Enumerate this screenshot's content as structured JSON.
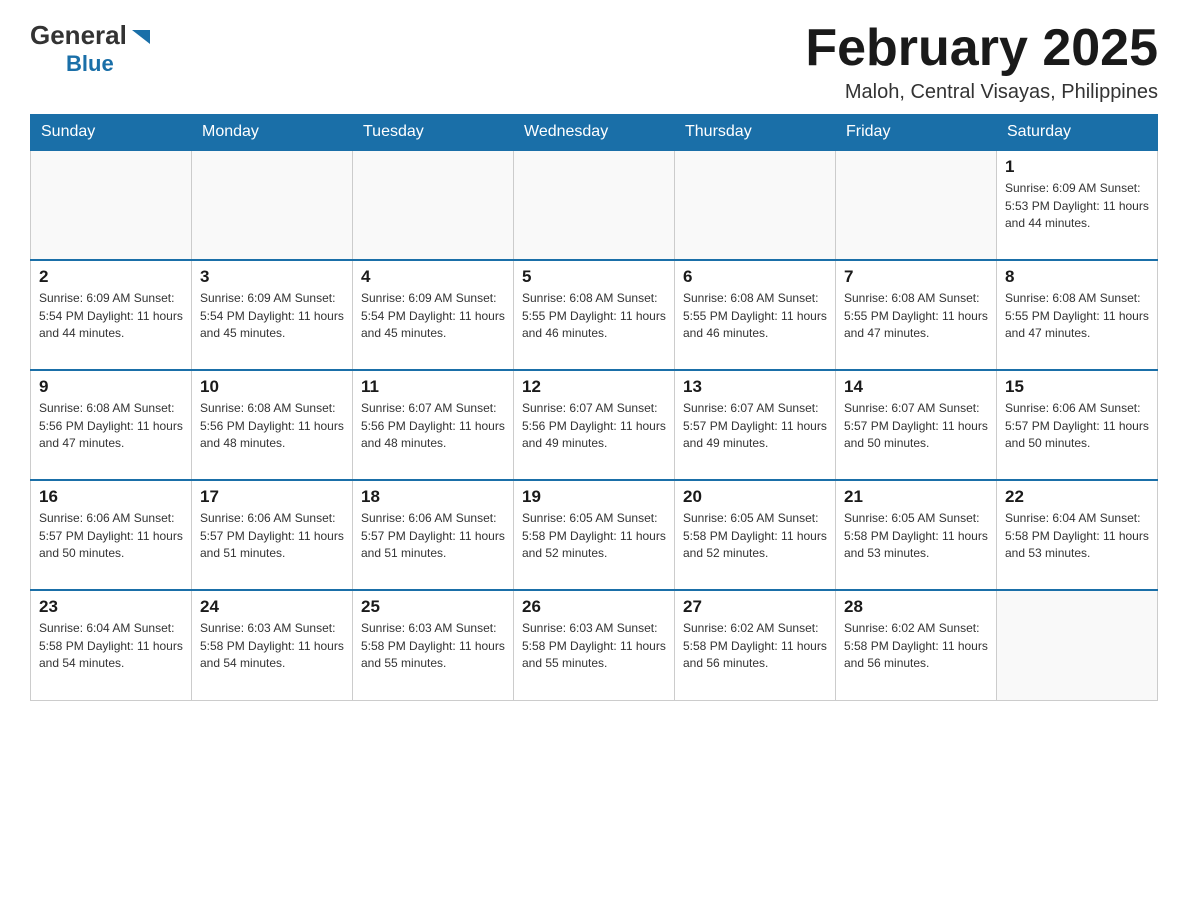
{
  "logo": {
    "general": "General",
    "blue": "Blue"
  },
  "title": "February 2025",
  "subtitle": "Maloh, Central Visayas, Philippines",
  "weekdays": [
    "Sunday",
    "Monday",
    "Tuesday",
    "Wednesday",
    "Thursday",
    "Friday",
    "Saturday"
  ],
  "weeks": [
    [
      {
        "day": "",
        "info": ""
      },
      {
        "day": "",
        "info": ""
      },
      {
        "day": "",
        "info": ""
      },
      {
        "day": "",
        "info": ""
      },
      {
        "day": "",
        "info": ""
      },
      {
        "day": "",
        "info": ""
      },
      {
        "day": "1",
        "info": "Sunrise: 6:09 AM\nSunset: 5:53 PM\nDaylight: 11 hours\nand 44 minutes."
      }
    ],
    [
      {
        "day": "2",
        "info": "Sunrise: 6:09 AM\nSunset: 5:54 PM\nDaylight: 11 hours\nand 44 minutes."
      },
      {
        "day": "3",
        "info": "Sunrise: 6:09 AM\nSunset: 5:54 PM\nDaylight: 11 hours\nand 45 minutes."
      },
      {
        "day": "4",
        "info": "Sunrise: 6:09 AM\nSunset: 5:54 PM\nDaylight: 11 hours\nand 45 minutes."
      },
      {
        "day": "5",
        "info": "Sunrise: 6:08 AM\nSunset: 5:55 PM\nDaylight: 11 hours\nand 46 minutes."
      },
      {
        "day": "6",
        "info": "Sunrise: 6:08 AM\nSunset: 5:55 PM\nDaylight: 11 hours\nand 46 minutes."
      },
      {
        "day": "7",
        "info": "Sunrise: 6:08 AM\nSunset: 5:55 PM\nDaylight: 11 hours\nand 47 minutes."
      },
      {
        "day": "8",
        "info": "Sunrise: 6:08 AM\nSunset: 5:55 PM\nDaylight: 11 hours\nand 47 minutes."
      }
    ],
    [
      {
        "day": "9",
        "info": "Sunrise: 6:08 AM\nSunset: 5:56 PM\nDaylight: 11 hours\nand 47 minutes."
      },
      {
        "day": "10",
        "info": "Sunrise: 6:08 AM\nSunset: 5:56 PM\nDaylight: 11 hours\nand 48 minutes."
      },
      {
        "day": "11",
        "info": "Sunrise: 6:07 AM\nSunset: 5:56 PM\nDaylight: 11 hours\nand 48 minutes."
      },
      {
        "day": "12",
        "info": "Sunrise: 6:07 AM\nSunset: 5:56 PM\nDaylight: 11 hours\nand 49 minutes."
      },
      {
        "day": "13",
        "info": "Sunrise: 6:07 AM\nSunset: 5:57 PM\nDaylight: 11 hours\nand 49 minutes."
      },
      {
        "day": "14",
        "info": "Sunrise: 6:07 AM\nSunset: 5:57 PM\nDaylight: 11 hours\nand 50 minutes."
      },
      {
        "day": "15",
        "info": "Sunrise: 6:06 AM\nSunset: 5:57 PM\nDaylight: 11 hours\nand 50 minutes."
      }
    ],
    [
      {
        "day": "16",
        "info": "Sunrise: 6:06 AM\nSunset: 5:57 PM\nDaylight: 11 hours\nand 50 minutes."
      },
      {
        "day": "17",
        "info": "Sunrise: 6:06 AM\nSunset: 5:57 PM\nDaylight: 11 hours\nand 51 minutes."
      },
      {
        "day": "18",
        "info": "Sunrise: 6:06 AM\nSunset: 5:57 PM\nDaylight: 11 hours\nand 51 minutes."
      },
      {
        "day": "19",
        "info": "Sunrise: 6:05 AM\nSunset: 5:58 PM\nDaylight: 11 hours\nand 52 minutes."
      },
      {
        "day": "20",
        "info": "Sunrise: 6:05 AM\nSunset: 5:58 PM\nDaylight: 11 hours\nand 52 minutes."
      },
      {
        "day": "21",
        "info": "Sunrise: 6:05 AM\nSunset: 5:58 PM\nDaylight: 11 hours\nand 53 minutes."
      },
      {
        "day": "22",
        "info": "Sunrise: 6:04 AM\nSunset: 5:58 PM\nDaylight: 11 hours\nand 53 minutes."
      }
    ],
    [
      {
        "day": "23",
        "info": "Sunrise: 6:04 AM\nSunset: 5:58 PM\nDaylight: 11 hours\nand 54 minutes."
      },
      {
        "day": "24",
        "info": "Sunrise: 6:03 AM\nSunset: 5:58 PM\nDaylight: 11 hours\nand 54 minutes."
      },
      {
        "day": "25",
        "info": "Sunrise: 6:03 AM\nSunset: 5:58 PM\nDaylight: 11 hours\nand 55 minutes."
      },
      {
        "day": "26",
        "info": "Sunrise: 6:03 AM\nSunset: 5:58 PM\nDaylight: 11 hours\nand 55 minutes."
      },
      {
        "day": "27",
        "info": "Sunrise: 6:02 AM\nSunset: 5:58 PM\nDaylight: 11 hours\nand 56 minutes."
      },
      {
        "day": "28",
        "info": "Sunrise: 6:02 AM\nSunset: 5:58 PM\nDaylight: 11 hours\nand 56 minutes."
      },
      {
        "day": "",
        "info": ""
      }
    ]
  ]
}
